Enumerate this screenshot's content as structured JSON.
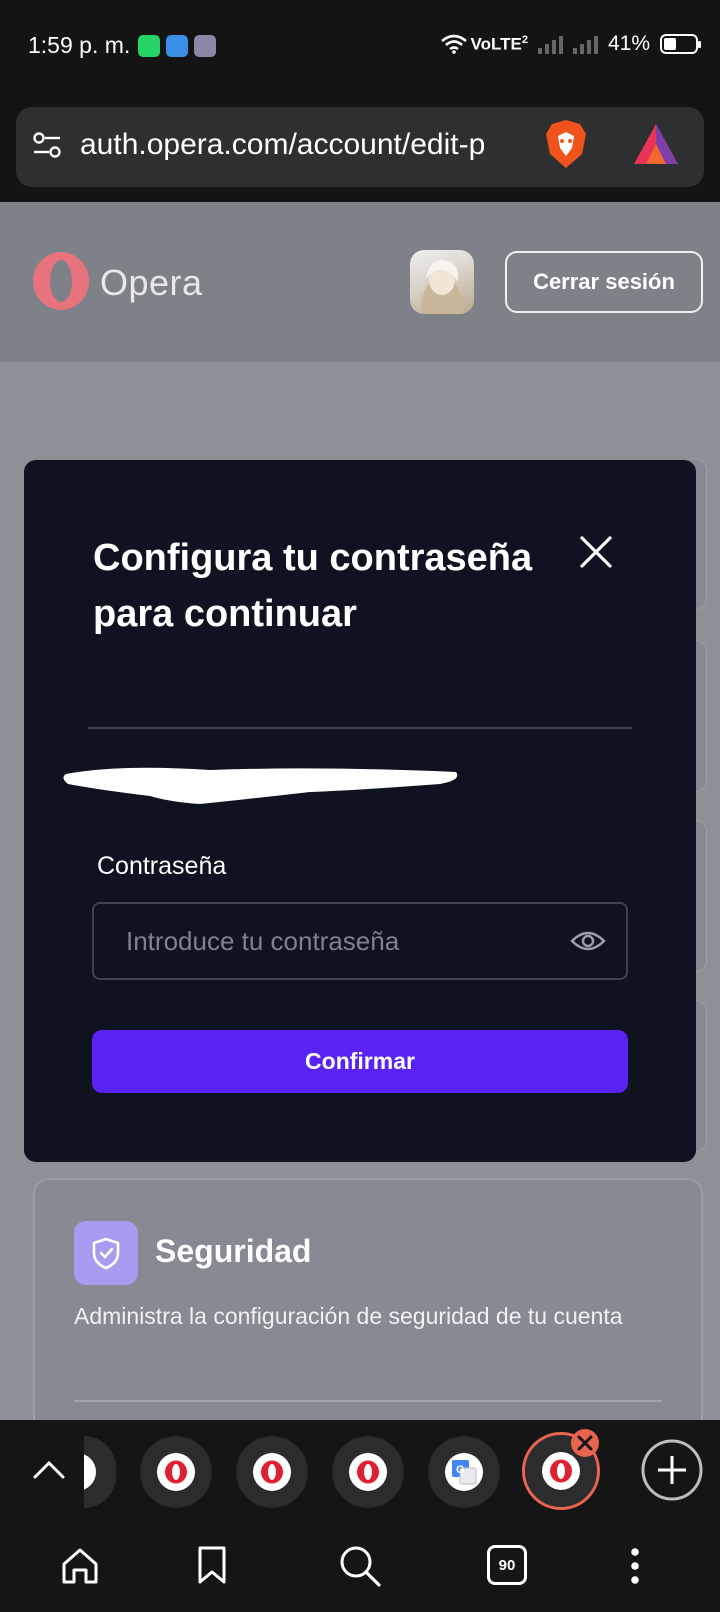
{
  "status_bar": {
    "time": "1:59 p. m.",
    "network": "VoLTE",
    "sim_index": "2",
    "battery": "41%",
    "battery_level": 0.41
  },
  "browser": {
    "url": "auth.opera.com/account/edit-p",
    "tab_count": "90"
  },
  "header": {
    "brand": "Opera",
    "logout_label": "Cerrar sesión"
  },
  "modal": {
    "title": "Configura tu contraseña para continuar",
    "password_label": "Contraseña",
    "password_placeholder": "Introduce tu contraseña",
    "confirm_label": "Confirmar"
  },
  "security": {
    "title": "Seguridad",
    "description": "Administra la configuración de seguridad de tu cuenta"
  },
  "colors": {
    "accent": "#5b22f5",
    "opera_red": "#e63a48",
    "modal_bg": "#0f1221"
  }
}
